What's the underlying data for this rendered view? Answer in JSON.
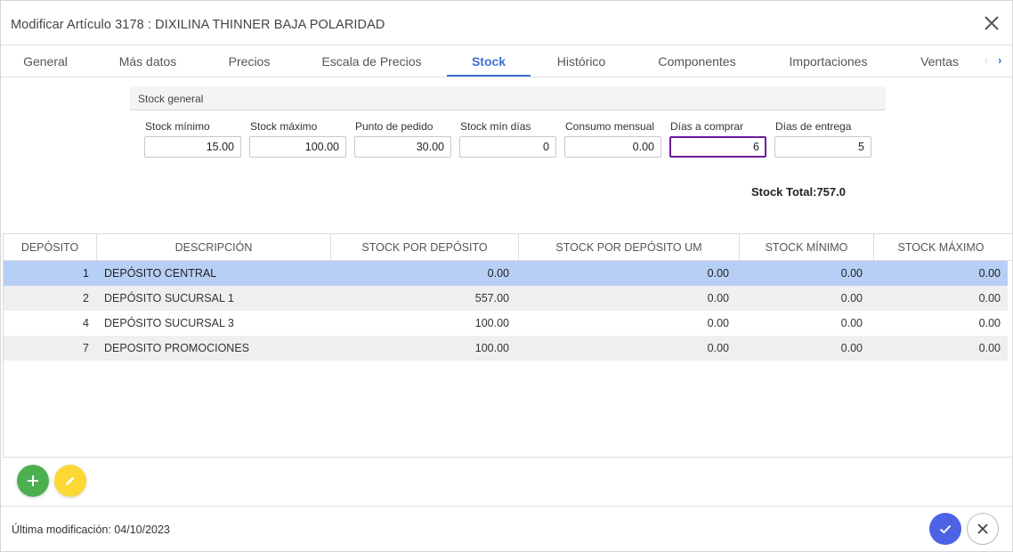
{
  "dialog": {
    "title": "Modificar Artículo 3178 : DIXILINA THINNER BAJA POLARIDAD"
  },
  "tabs": [
    {
      "label": "General"
    },
    {
      "label": "Más datos"
    },
    {
      "label": "Precios"
    },
    {
      "label": "Escala de Precios"
    },
    {
      "label": "Stock"
    },
    {
      "label": "Histórico"
    },
    {
      "label": "Componentes"
    },
    {
      "label": "Importaciones"
    },
    {
      "label": "Ventas"
    }
  ],
  "active_tab": "Stock",
  "stock_general": {
    "heading": "Stock general",
    "fields": [
      {
        "label": "Stock mínimo",
        "value": "15.00"
      },
      {
        "label": "Stock máximo",
        "value": "100.00"
      },
      {
        "label": "Punto de pedido",
        "value": "30.00"
      },
      {
        "label": "Stock mín días",
        "value": "0"
      },
      {
        "label": "Consumo mensual",
        "value": "0.00"
      },
      {
        "label": "Días a comprar",
        "value": "6"
      },
      {
        "label": "Días de entrega",
        "value": "5"
      }
    ],
    "total_label": "Stock Total:",
    "total_value": "757.0"
  },
  "table": {
    "headers": [
      "DEPÓSITO",
      "DESCRIPCIÓN",
      "STOCK POR DEPÓSITO",
      "STOCK POR DEPÓSITO UM",
      "STOCK MÍNIMO",
      "STOCK MÁXIMO"
    ],
    "rows": [
      {
        "deposito": "1",
        "descripcion": "DEPÓSITO CENTRAL",
        "stock": "0.00",
        "stock_um": "0.00",
        "minimo": "0.00",
        "maximo": "0.00"
      },
      {
        "deposito": "2",
        "descripcion": "DEPÓSITO SUCURSAL 1",
        "stock": "557.00",
        "stock_um": "0.00",
        "minimo": "0.00",
        "maximo": "0.00"
      },
      {
        "deposito": "4",
        "descripcion": "DEPÓSITO SUCURSAL 3",
        "stock": "100.00",
        "stock_um": "0.00",
        "minimo": "0.00",
        "maximo": "0.00"
      },
      {
        "deposito": "7",
        "descripcion": "DEPOSITO PROMOCIONES",
        "stock": "100.00",
        "stock_um": "0.00",
        "minimo": "0.00",
        "maximo": "0.00"
      }
    ]
  },
  "footer": {
    "last_modified": "Última modificación: 04/10/2023"
  },
  "icons": {
    "close": "close-icon",
    "add": "plus-icon",
    "edit": "pencil-icon",
    "confirm": "check-icon",
    "cancel": "close-icon"
  },
  "colors": {
    "accent": "#3f6fd8",
    "selected_row": "#b7cff5",
    "add_button": "#4caf50",
    "edit_button": "#fdd835",
    "confirm_button": "#4d63e6",
    "focused_field": "#6a1b9a"
  }
}
